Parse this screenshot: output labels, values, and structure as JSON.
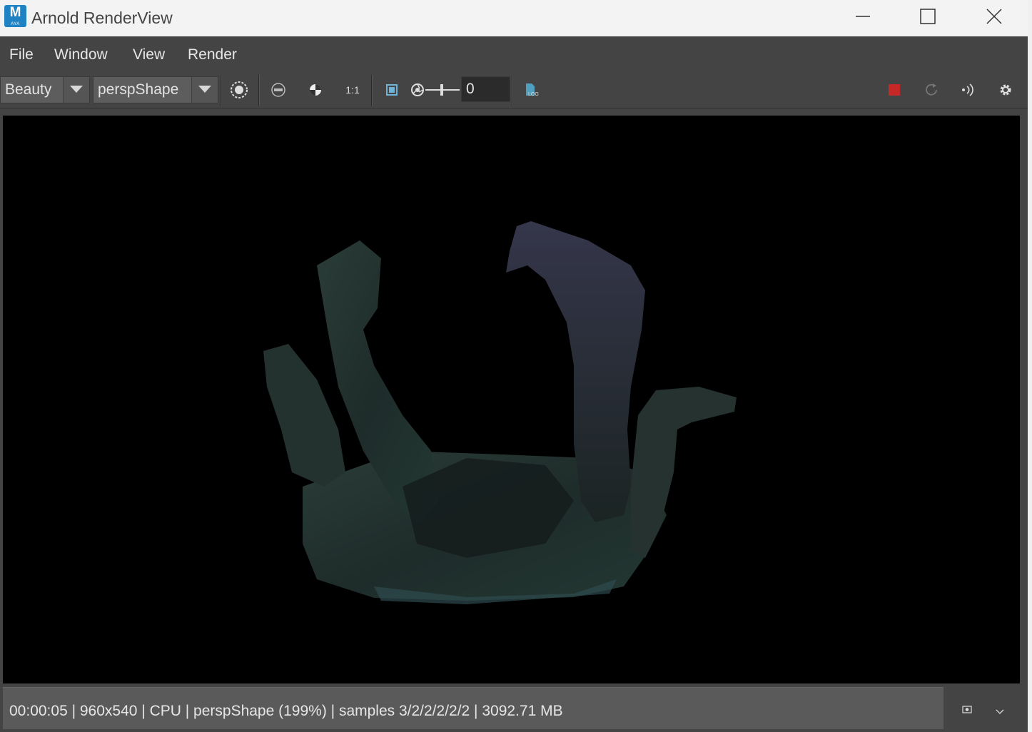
{
  "window": {
    "title": "Arnold RenderView",
    "app_icon_letter": "M",
    "app_icon_sub": "AYA"
  },
  "menu": {
    "items": [
      "File",
      "Window",
      "View",
      "Render"
    ]
  },
  "toolbar": {
    "aov_select": "Beauty",
    "camera_select": "perspShape",
    "ratio_label": "1:1",
    "exposure_value": "0",
    "log_label": "LOG",
    "colors": {
      "stop_button": "#c62828"
    }
  },
  "status": {
    "text": "00:00:05 | 960x540 | CPU | perspShape (199%) | samples 3/2/2/2/2/2 | 3092.71 MB"
  }
}
